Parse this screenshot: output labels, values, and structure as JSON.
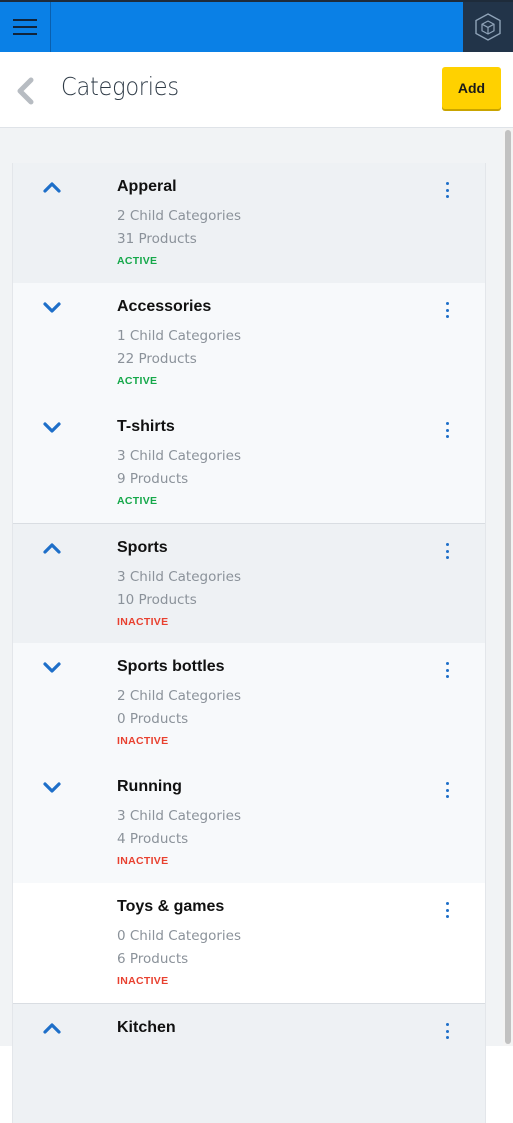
{
  "topbar": {
    "menu_icon": "hamburger-menu-icon",
    "brand_icon": "cube-logo-icon",
    "colors": {
      "bar": "#0a80e6",
      "brand_bg": "#223449"
    }
  },
  "header": {
    "back_icon": "chevron-left-icon",
    "title": "Categories",
    "add_label": "Add",
    "add_color": "#ffd100"
  },
  "categories": [
    {
      "name": "Apperal",
      "children": "2 Child Categories",
      "products": "31 Products",
      "status": "ACTIVE",
      "chevron": "up",
      "bg": "#eef1f4"
    },
    {
      "name": "Accessories",
      "children": "1 Child Categories",
      "products": "22 Products",
      "status": "ACTIVE",
      "chevron": "down",
      "bg": "#f7f9fb"
    },
    {
      "name": "T-shirts",
      "children": "3 Child Categories",
      "products": "9 Products",
      "status": "ACTIVE",
      "chevron": "down",
      "bg": "#f7f9fb"
    },
    {
      "name": "Sports",
      "children": "3 Child Categories",
      "products": "10 Products",
      "status": "INACTIVE",
      "chevron": "up",
      "bg": "#eef1f4"
    },
    {
      "name": "Sports bottles",
      "children": "2 Child Categories",
      "products": "0 Products",
      "status": "INACTIVE",
      "chevron": "down",
      "bg": "#f7f9fb"
    },
    {
      "name": "Running",
      "children": "3 Child Categories",
      "products": "4 Products",
      "status": "INACTIVE",
      "chevron": "down",
      "bg": "#f7f9fb"
    },
    {
      "name": "Toys & games",
      "children": "0 Child Categories",
      "products": "6 Products",
      "status": "INACTIVE",
      "chevron": "none",
      "bg": "#ffffff"
    },
    {
      "name": "Kitchen",
      "children": "",
      "products": "",
      "status": "",
      "chevron": "up",
      "bg": "#eef1f4"
    }
  ],
  "status_colors": {
    "active": "#15a84a",
    "inactive": "#e8402f"
  }
}
